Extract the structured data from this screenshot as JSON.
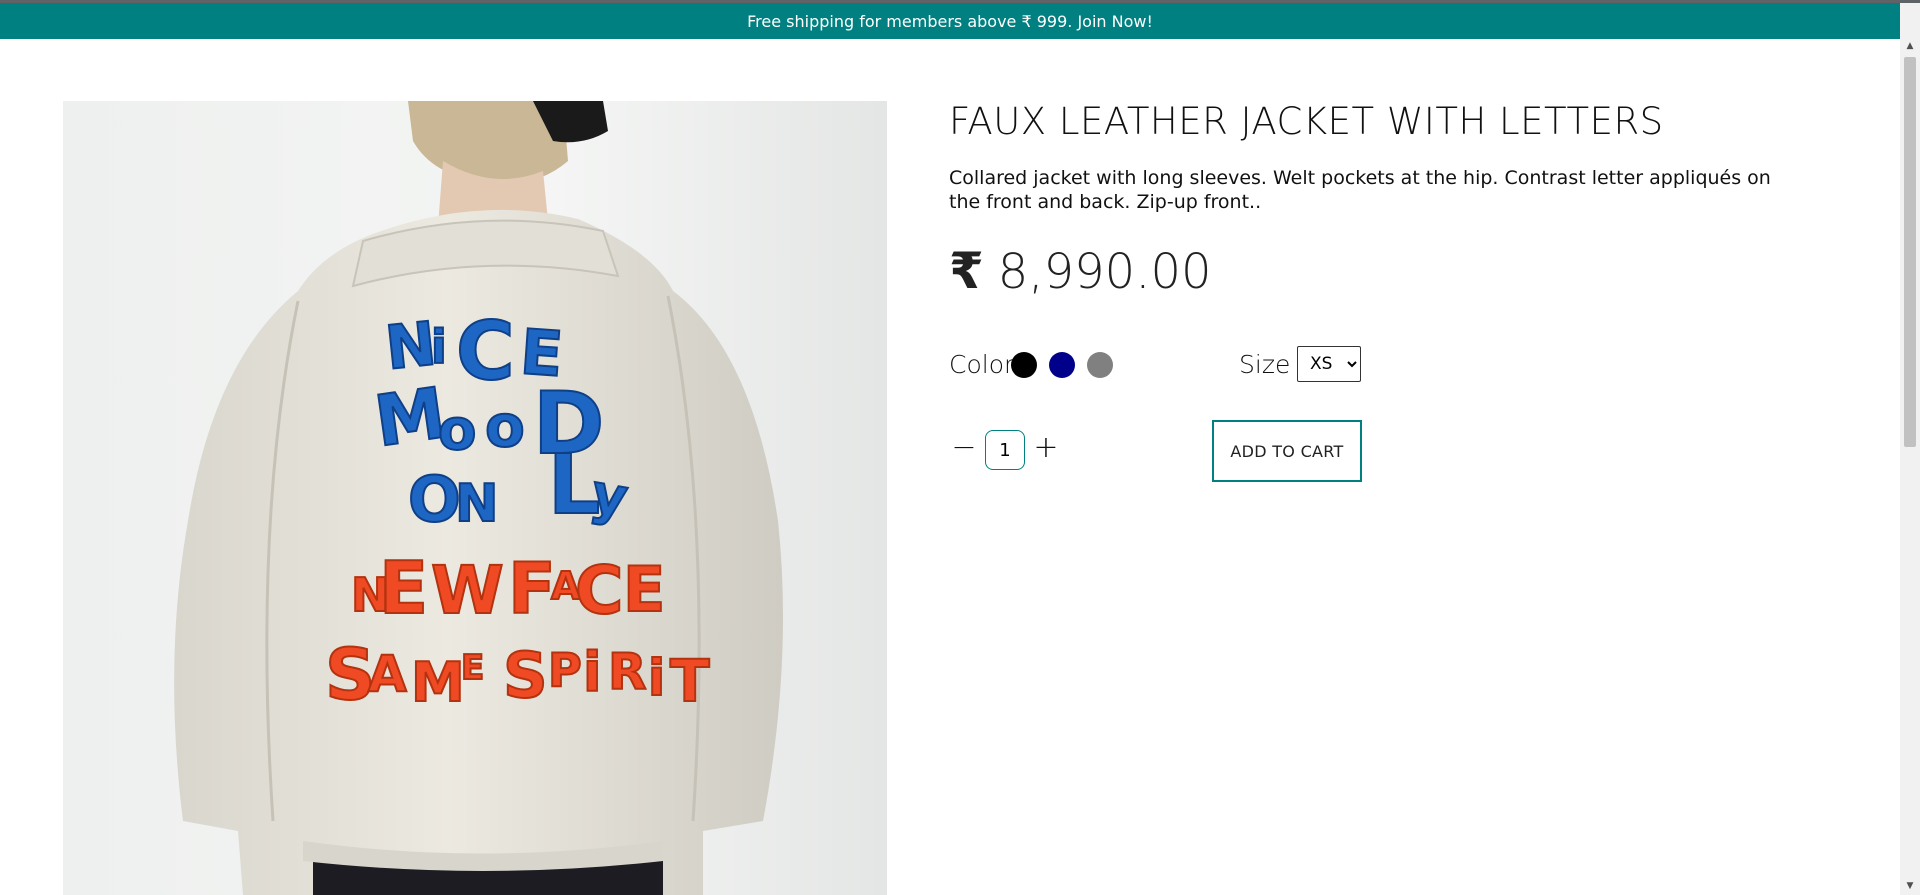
{
  "promo": {
    "text": "Free shipping for members above ₹ 999. Join Now!"
  },
  "product": {
    "title": "FAUX LEATHER JACKET WITH LETTERS",
    "description": "Collared jacket with long sleeves. Welt pockets at the hip. Contrast letter appliqués on the front and back. Zip-up front..",
    "currency": "₹",
    "price": "8,990.00",
    "image": {
      "alt": "Back view of light faux leather jacket with letter appliqués",
      "appliques_blue": [
        "NICE",
        "MOOD",
        "ONLY"
      ],
      "appliques_orange": [
        "NEW FACE",
        "SAME SPIRIT"
      ]
    }
  },
  "options": {
    "color_label": "Color",
    "colors": [
      {
        "name": "black",
        "hex": "#000000"
      },
      {
        "name": "navy",
        "hex": "#00008b"
      },
      {
        "name": "gray",
        "hex": "#808080"
      }
    ],
    "size_label": "Size",
    "size_selected": "XS",
    "size_options": [
      "XS"
    ]
  },
  "quantity": {
    "value": "1",
    "minus_icon": "minus-icon",
    "plus_icon": "plus-icon"
  },
  "cart": {
    "add_label": "ADD TO CART"
  },
  "theme": {
    "accent": "#008080"
  }
}
